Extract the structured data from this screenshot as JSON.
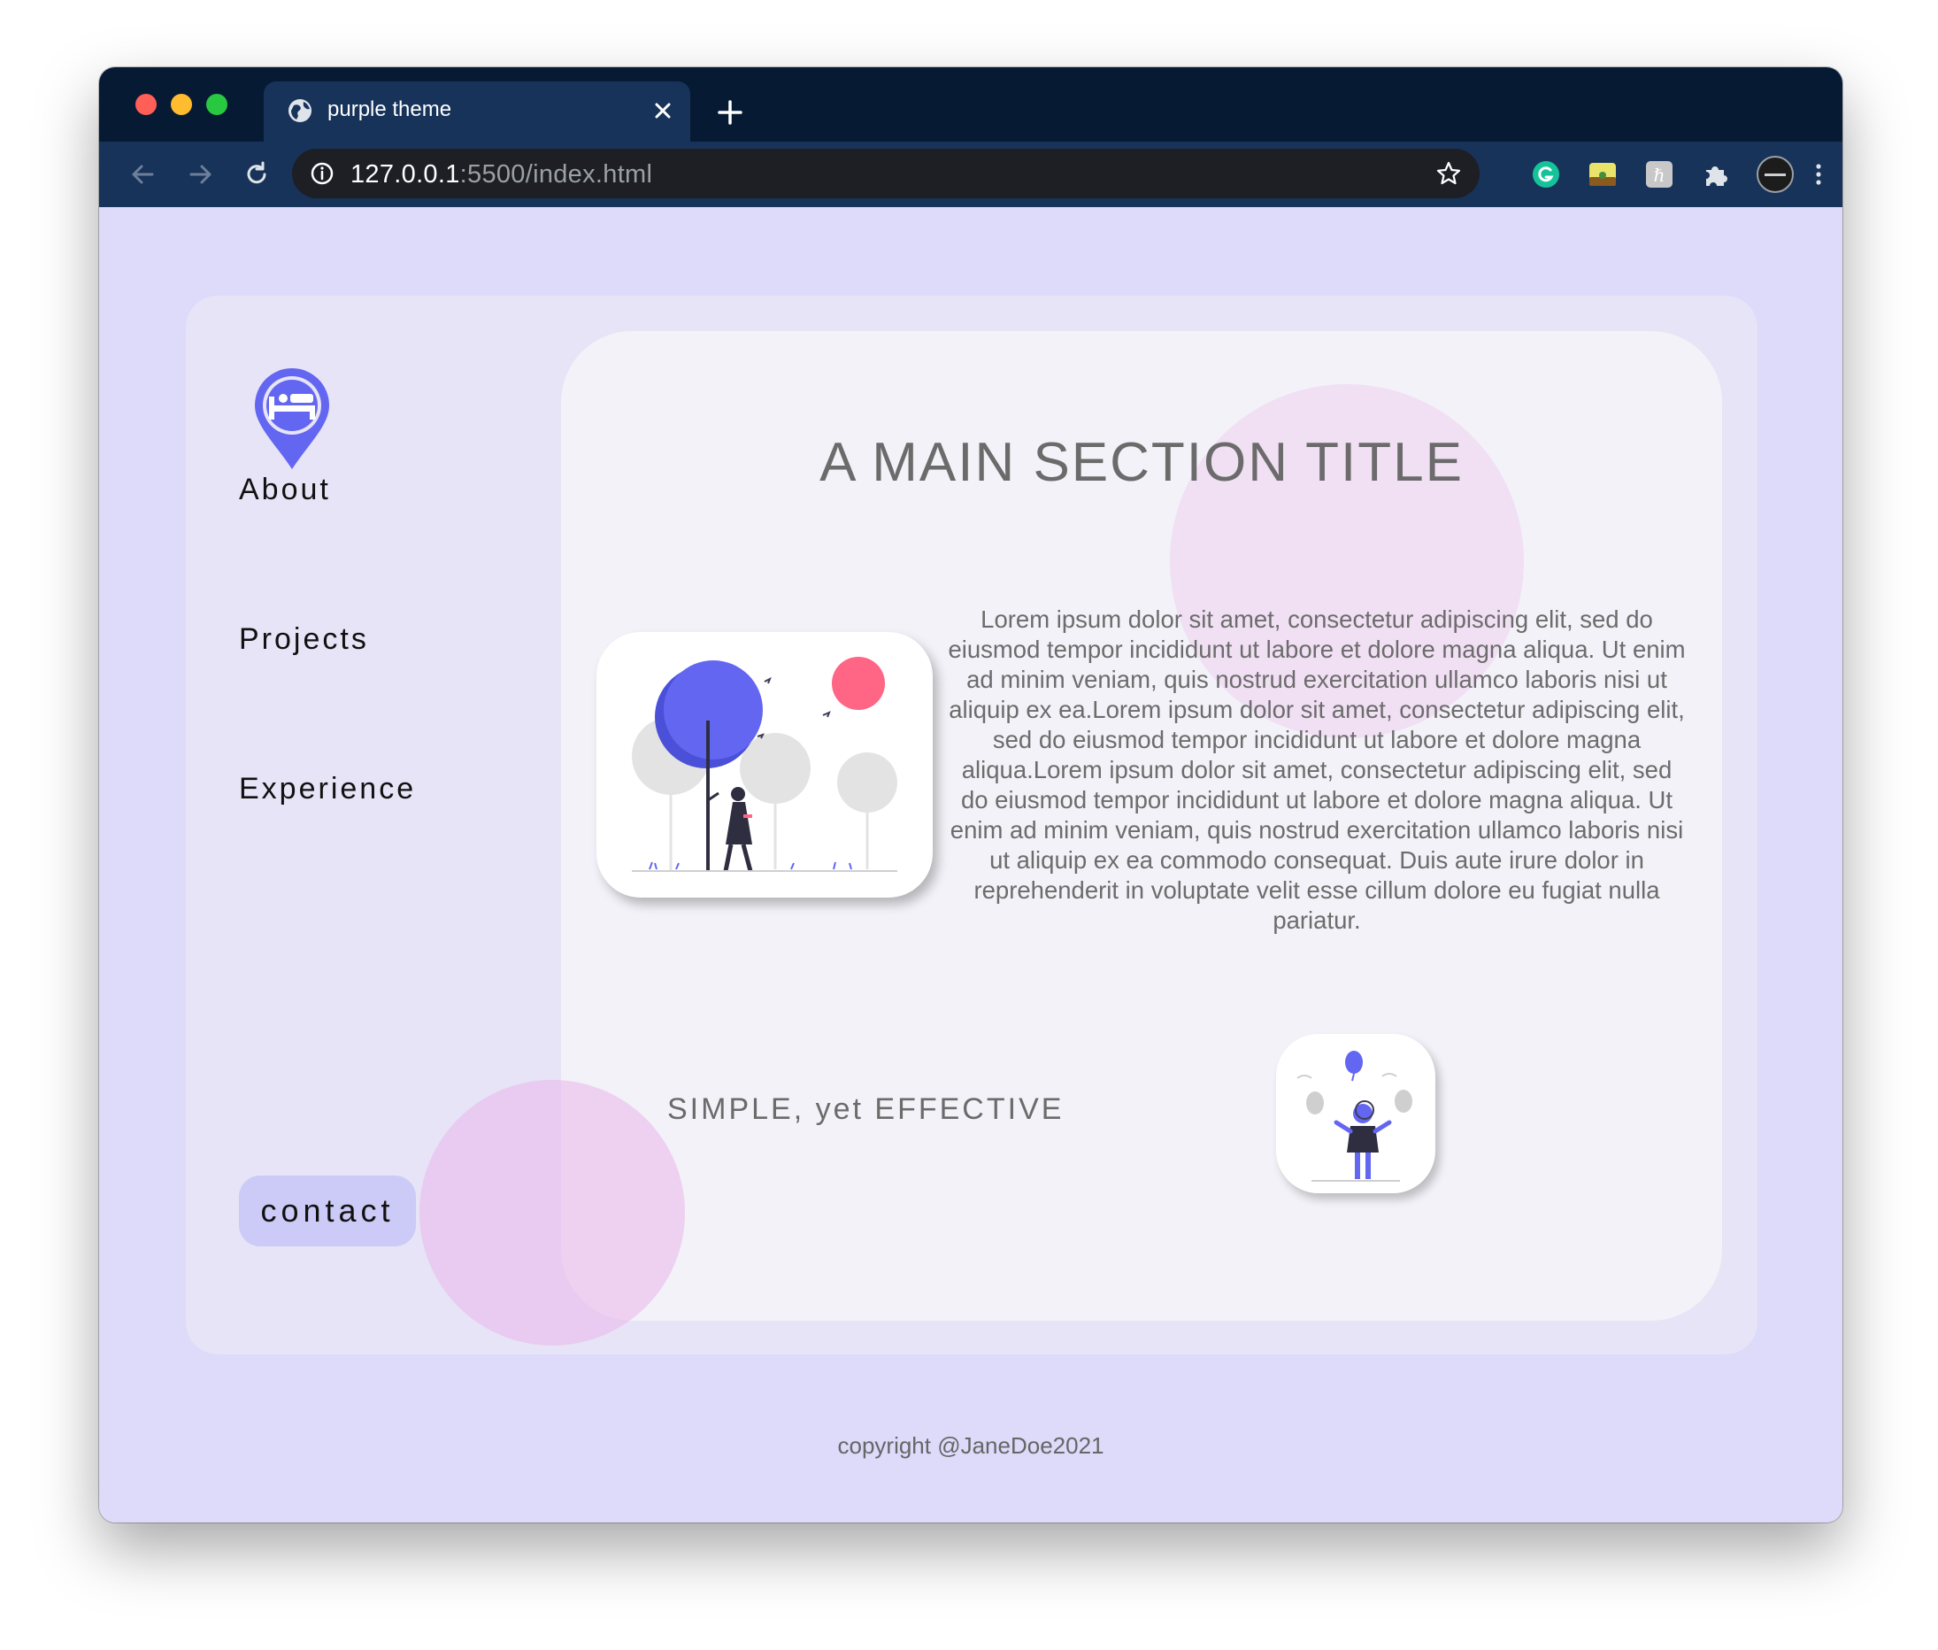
{
  "browser": {
    "tab_title": "purple theme",
    "url_host": "127.0.0.1",
    "url_rest": ":5500/index.html"
  },
  "sidebar": {
    "nav_items": [
      {
        "label": "About"
      },
      {
        "label": "Projects"
      },
      {
        "label": "Experience"
      }
    ],
    "contact_label": "contact"
  },
  "main": {
    "title": "A MAIN SECTION TITLE",
    "body": "Lorem ipsum dolor sit amet, consectetur adipiscing elit, sed do eiusmod tempor incididunt ut labore et dolore magna aliqua. Ut enim ad minim veniam, quis nostrud exercitation ullamco laboris nisi ut aliquip ex ea.Lorem ipsum dolor sit amet, consectetur adipiscing elit, sed do eiusmod tempor incididunt ut labore et dolore magna aliqua.Lorem ipsum dolor sit amet, consectetur adipiscing elit, sed do eiusmod tempor incididunt ut labore et dolore magna aliqua. Ut enim ad minim veniam, quis nostrud exercitation ullamco laboris nisi ut aliquip ex ea commodo consequat. Duis aute irure dolor in reprehenderit in voluptate velit esse cillum dolore eu fugiat nulla pariatur.",
    "tagline": "SIMPLE, yet EFFECTIVE"
  },
  "footer": {
    "copyright": "copyright @JaneDoe2021"
  },
  "colors": {
    "accent": "#6366f1",
    "page_bg": "#dddafa",
    "contact_bg": "#cccaf6",
    "bubble": "#f0c8f0",
    "chrome_dark": "#071a33",
    "chrome_toolbar": "#17335a"
  },
  "icons": {
    "logo": "hotel-location-pin-icon",
    "extensions": [
      "grammarly-icon",
      "landscape-extension-icon",
      "h-extension-icon",
      "puzzle-icon",
      "profile-avatar-icon"
    ]
  }
}
